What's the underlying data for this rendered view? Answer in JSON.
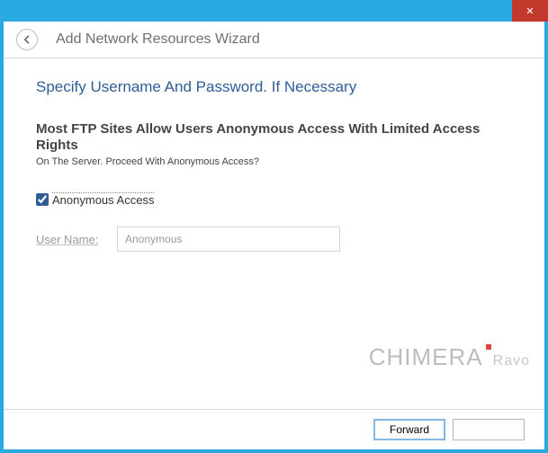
{
  "titlebar": {
    "close_label": "✕"
  },
  "header": {
    "wizard_title": "Add Network Resources Wizard"
  },
  "page": {
    "title": "Specify Username And Password. If Necessary",
    "main_text": "Most FTP Sites Allow Users Anonymous Access With Limited Access Rights",
    "sub_text": "On The Server. Proceed With Anonymous Access?"
  },
  "fields": {
    "anon_checkbox_label": "Anonymous Access",
    "anon_checked": true,
    "username_label": "User Name:",
    "username_value": "Anonymous"
  },
  "footer": {
    "forward_label": "Forward"
  },
  "watermark": {
    "main": "CHIMERA",
    "sub": "Ravo"
  }
}
